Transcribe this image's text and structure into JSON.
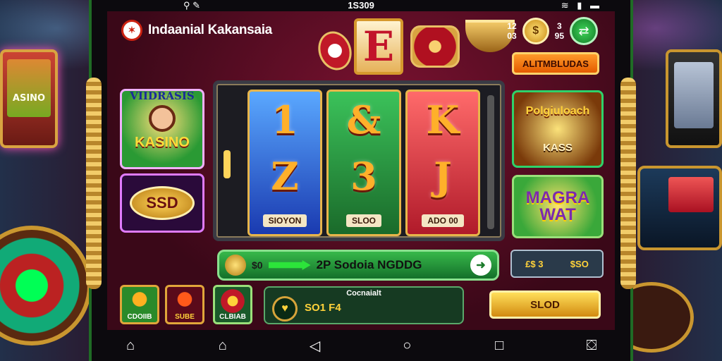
{
  "status": {
    "time": "1S309",
    "left_icons": "⚲ ✎",
    "right_icons": "≋ ▮ ▬"
  },
  "brand": {
    "name": "Indaanial Kakansaia",
    "logo": "✶"
  },
  "hero": {
    "glyph": "E"
  },
  "top_right": {
    "num1": "12\n03",
    "num2": "3\n95",
    "coin": "$",
    "action_icon": "⇄"
  },
  "top_button": {
    "label": "ALITMBLUDAS"
  },
  "left_tiles": {
    "kasino": {
      "title": "VIIDRASIS",
      "label": "KASINO"
    },
    "ssd": {
      "label": "SSD"
    }
  },
  "reels": [
    {
      "top": "1",
      "bottom": "Z",
      "label": "SIOYON"
    },
    {
      "top": "&",
      "bottom": "3",
      "label": "SLOO"
    },
    {
      "top": "K",
      "bottom": "J",
      "label": "ADO 00"
    }
  ],
  "right_tiles": {
    "pot": {
      "title": "Polgiuloach",
      "label": "KASS"
    },
    "mega": {
      "line1": "MAGRA",
      "line2": "WAT"
    }
  },
  "spinbar": {
    "prefix": "$0",
    "text": "2P Sodoia NGDDG",
    "go": "➜"
  },
  "stat": {
    "left": "£$ 3",
    "right": "$SO"
  },
  "squares": [
    {
      "label": "CDOIIB"
    },
    {
      "label": "SUBE"
    },
    {
      "label": "CLBIAB"
    }
  ],
  "balance": {
    "caption": "Cocnaialt",
    "value": "SO1 F4",
    "icon": "♥"
  },
  "buy_button": {
    "label": "SLOD"
  },
  "nav": {
    "icons": [
      "⌂",
      "⌂",
      "◁",
      "○",
      "□",
      "⛋"
    ]
  },
  "colors": {
    "accent": "#ffd23a",
    "frame": "#1f6b25",
    "screen": "#7a1230"
  }
}
